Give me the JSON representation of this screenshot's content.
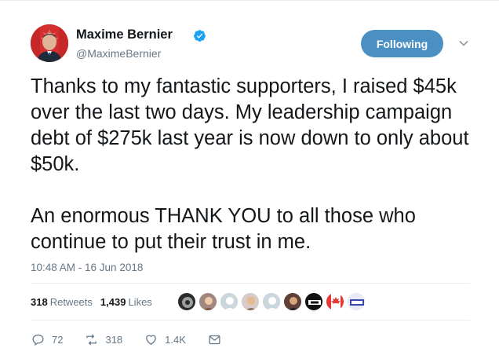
{
  "author": {
    "name": "Maxime Bernier",
    "handle": "@MaximeBernier",
    "verified": true,
    "avatar_icon": "profile-photo-with-canada-flag"
  },
  "follow_button": {
    "label": "Following"
  },
  "menu_icon": "chevron-down-icon",
  "tweet": {
    "paragraphs": [
      "Thanks to my fantastic supporters, I raised $45k over the last two days. My leadership campaign debt of $275k last year is now down to only about $50k.",
      "An enormous THANK YOU to all those who continue to put their trust in me."
    ],
    "timestamp": "10:48 AM - 16 Jun 2018"
  },
  "stats": {
    "retweets_count": "318",
    "retweets_label": "Retweets",
    "likes_count": "1,439",
    "likes_label": "Likes"
  },
  "liker_avatars": [
    "avatar-1",
    "avatar-2",
    "avatar-3",
    "avatar-4",
    "avatar-5",
    "avatar-6",
    "avatar-7",
    "avatar-8",
    "avatar-9"
  ],
  "actions": {
    "reply_count": "72",
    "retweet_count": "318",
    "like_count": "1.4K"
  },
  "colors": {
    "follow_button": "#4a90c2",
    "verified": "#1da1f2",
    "secondary_text": "#657786",
    "divider": "#e6ecf0"
  }
}
